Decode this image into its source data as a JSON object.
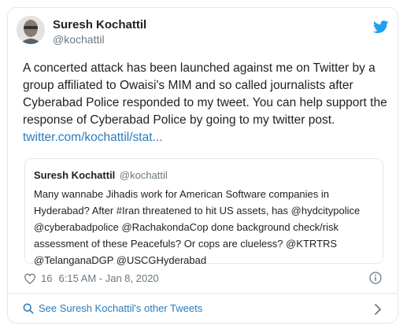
{
  "author": {
    "name": "Suresh Kochattil",
    "handle": "@kochattil"
  },
  "tweet": {
    "text": "A concerted attack has been launched against me on Twitter by a group affiliated to Owaisi's MIM and so called journalists after Cyberabad Police responded to my tweet. You can help support the response of Cyberabad Police by going to my twitter post.",
    "link": "twitter.com/kochattil/stat..."
  },
  "quoted": {
    "name": "Suresh Kochattil",
    "handle": "@kochattil",
    "text": "Many wannabe Jihadis work for American Software companies in Hyderabad? After #Iran threatened to hit US assets, has @hydcitypolice @cyberabadpolice @RachakondaCop done background check/risk assessment of these Peacefuls? Or cops are clueless? @KTRTRS @TelanganaDGP @USCGHyderabad"
  },
  "meta": {
    "likes": "16",
    "timestamp": "6:15 AM - Jan 8, 2020"
  },
  "footer": {
    "more_tweets": "See Suresh Kochattil's other Tweets"
  },
  "icons": {
    "brand": "twitter-bird-icon",
    "like": "heart-icon",
    "info": "info-icon",
    "search": "search-icon",
    "chevron": "chevron-right-icon"
  },
  "colors": {
    "link": "#2b7bb9",
    "twitter_blue": "#1da1f2",
    "muted": "#697882",
    "border": "#e1e8ed"
  }
}
